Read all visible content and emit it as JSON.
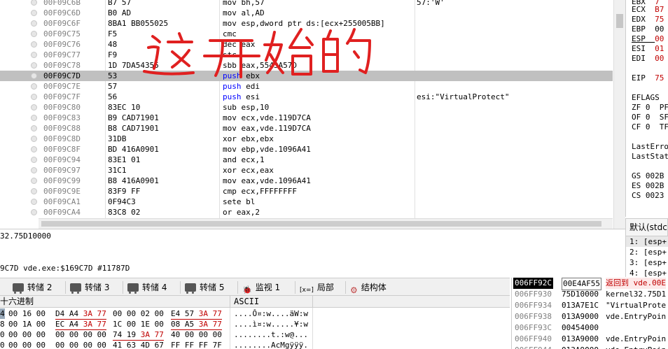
{
  "disasm": {
    "rows": [
      {
        "addr": "00F09C6B",
        "bytes": "B7 57",
        "instr_op": "mov ",
        "instr_args": "bh,57",
        "comment": "57:'W'"
      },
      {
        "addr": "00F09C6D",
        "bytes": "B0 AD",
        "instr_op": "mov ",
        "instr_args": "al,AD",
        "comment": ""
      },
      {
        "addr": "00F09C6F",
        "bytes": "8BA1 BB055025",
        "instr_op": "mov ",
        "instr_args": "esp,dword ptr ds:[ecx+255005BB]",
        "comment": ""
      },
      {
        "addr": "00F09C75",
        "bytes": "F5",
        "instr_op": "cmc",
        "instr_args": "",
        "comment": ""
      },
      {
        "addr": "00F09C76",
        "bytes": "48",
        "instr_op": "dec ",
        "instr_args": "eax",
        "comment": ""
      },
      {
        "addr": "00F09C77",
        "bytes": "F9",
        "instr_op": "stc",
        "instr_args": "",
        "comment": ""
      },
      {
        "addr": "00F09C78",
        "bytes": "1D 7DA54355",
        "instr_op": "sbb ",
        "instr_args": "eax,5543A57D",
        "comment": ""
      },
      {
        "addr": "00F09C7D",
        "bytes": "53",
        "instr_op": "push ",
        "instr_args": "ebx",
        "comment": "",
        "selected": true
      },
      {
        "addr": "00F09C7E",
        "bytes": "57",
        "instr_op": "push ",
        "instr_args": "edi",
        "comment": ""
      },
      {
        "addr": "00F09C7F",
        "bytes": "56",
        "instr_op": "push ",
        "instr_args": "esi",
        "comment": "esi:\"VirtualProtect\""
      },
      {
        "addr": "00F09C80",
        "bytes": "83EC 10",
        "instr_op": "sub ",
        "instr_args": "esp,10",
        "comment": ""
      },
      {
        "addr": "00F09C83",
        "bytes": "B9 CAD71901",
        "instr_op": "mov ",
        "instr_args": "ecx,vde.119D7CA",
        "comment": ""
      },
      {
        "addr": "00F09C88",
        "bytes": "B8 CAD71901",
        "instr_op": "mov ",
        "instr_args": "eax,vde.119D7CA",
        "comment": ""
      },
      {
        "addr": "00F09C8D",
        "bytes": "31DB",
        "instr_op": "xor ",
        "instr_args": "ebx,ebx",
        "comment": ""
      },
      {
        "addr": "00F09C8F",
        "bytes": "BD 416A0901",
        "instr_op": "mov ",
        "instr_args": "ebp,vde.1096A41",
        "comment": ""
      },
      {
        "addr": "00F09C94",
        "bytes": "83E1 01",
        "instr_op": "and ",
        "instr_args": "ecx,1",
        "comment": ""
      },
      {
        "addr": "00F09C97",
        "bytes": "31C1",
        "instr_op": "xor ",
        "instr_args": "ecx,eax",
        "comment": ""
      },
      {
        "addr": "00F09C99",
        "bytes": "B8 416A0901",
        "instr_op": "mov ",
        "instr_args": "eax,vde.1096A41",
        "comment": ""
      },
      {
        "addr": "00F09C9E",
        "bytes": "83F9 FF",
        "instr_op": "cmp ",
        "instr_args": "ecx,FFFFFFFF",
        "comment": ""
      },
      {
        "addr": "00F09CA1",
        "bytes": "0F94C3",
        "instr_op": "sete ",
        "instr_args": "bl",
        "comment": ""
      },
      {
        "addr": "00F09CA4",
        "bytes": "83C8 02",
        "instr_op": "or ",
        "instr_args": "eax,2",
        "comment": ""
      }
    ]
  },
  "annotation": {
    "text": "这开始的",
    "color": "#e02020"
  },
  "registers": [
    {
      "name": "EBX",
      "value": "7"
    },
    {
      "name": "ECX",
      "value": "B7"
    },
    {
      "name": "EDX",
      "value": "75"
    },
    {
      "name": "EBP",
      "value": "00",
      "black": true
    },
    {
      "name": "ESP",
      "value": "00"
    },
    {
      "name": "ESI",
      "value": "01"
    },
    {
      "name": "EDI",
      "value": "00"
    },
    {
      "name": "EIP",
      "value": "75"
    }
  ],
  "flags": [
    {
      "line": "EFLAGS"
    },
    {
      "line": "ZF 0  PF"
    },
    {
      "line": "OF 0  SF"
    },
    {
      "line": "CF 0  TF"
    }
  ],
  "last_err": [
    "LastErro",
    "LastStat"
  ],
  "segments": [
    "GS 002B",
    "ES 002B",
    "CS 0023"
  ],
  "stack_header": {
    "label": "默认(stdc"
  },
  "stack_args": [
    "1: [esp+",
    "2: [esp+",
    "3: [esp+",
    "4: [esp+"
  ],
  "info": {
    "line1": "32.75D10000",
    "line2": "9C7D vde.exe:$169C7D #11787D"
  },
  "tabs": [
    {
      "label": "转储 2",
      "icon": "truck"
    },
    {
      "label": "转储 3",
      "icon": "truck"
    },
    {
      "label": "转储 4",
      "icon": "truck"
    },
    {
      "label": "转储 5",
      "icon": "truck"
    },
    {
      "label": "监视 1",
      "icon": "watch"
    },
    {
      "label": "局部",
      "icon": "locals",
      "prefix": "[x=]"
    },
    {
      "label": "结构体",
      "icon": "struct"
    }
  ],
  "dump": {
    "hex_header": "十六进制",
    "ascii_header": "ASCII",
    "rows": [
      {
        "lead": "4",
        "hex": [
          [
            "00",
            "16",
            "00",
            "",
            ""
          ],
          [
            "D4",
            "A4",
            "3A",
            "77",
            "u"
          ],
          [
            "00",
            "00",
            "02",
            "00",
            ""
          ],
          [
            "E4",
            "57",
            "3A",
            "77",
            "u"
          ]
        ],
        "ascii": "....Ô¤:w....äW:w"
      },
      {
        "lead": "8",
        "hex": [
          [
            "00",
            "1A",
            "00",
            "",
            ""
          ],
          [
            "EC",
            "A4",
            "3A",
            "77",
            "u"
          ],
          [
            "1C",
            "00",
            "1E",
            "00",
            ""
          ],
          [
            "08",
            "A5",
            "3A",
            "77",
            "u"
          ]
        ],
        "ascii": "....ì¤:w.....¥:w"
      },
      {
        "lead": "0",
        "hex": [
          [
            "00",
            "00",
            "00",
            "",
            ""
          ],
          [
            "00",
            "00",
            "00",
            "00",
            ""
          ],
          [
            "74",
            "19",
            "3A",
            "77",
            "u"
          ],
          [
            "40",
            "00",
            "00",
            "00",
            ""
          ]
        ],
        "ascii": "........t.:w@..."
      },
      {
        "lead": "0",
        "hex": [
          [
            "00",
            "00",
            "00",
            "",
            ""
          ],
          [
            "00",
            "00",
            "00",
            "00",
            ""
          ],
          [
            "41",
            "63",
            "4D",
            "67",
            ""
          ],
          [
            "FF",
            "FF",
            "FF",
            "7F",
            ""
          ]
        ],
        "ascii": "........AcMgÿÿÿ."
      }
    ]
  },
  "stack": {
    "rows": [
      {
        "addr": "006FF92C",
        "val": "00E4AF55",
        "comment": "返回到 vde.00E",
        "hi": true
      },
      {
        "addr": "006FF930",
        "val": "75D10000",
        "comment": "kernel32.75D1"
      },
      {
        "addr": "006FF934",
        "val": "013A7E1C",
        "comment": "\"VirtualProte"
      },
      {
        "addr": "006FF938",
        "val": "013A9000",
        "comment": "vde.EntryPoin"
      },
      {
        "addr": "006FF93C",
        "val": "00454000",
        "comment": ""
      },
      {
        "addr": "006FF940",
        "val": "013A9000",
        "comment": "vde.EntryPoin"
      },
      {
        "addr": "006FF944",
        "val": "013A9000",
        "comment": "vde.EntryPoin"
      }
    ]
  }
}
